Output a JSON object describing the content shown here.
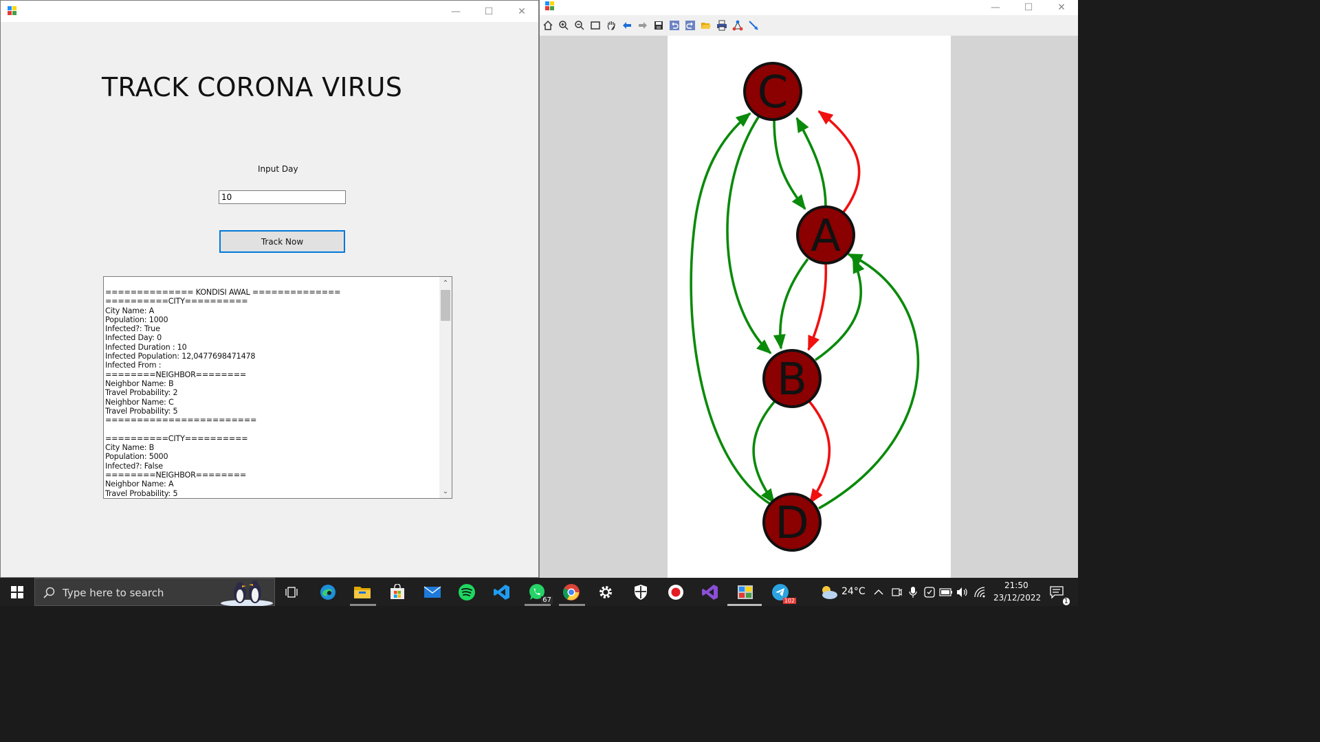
{
  "left_window": {
    "title": "TRACK CORONA VIRUS",
    "input_label": "Input Day",
    "input_value": "10",
    "button_label": "Track Now",
    "output_lines": [
      "============== KONDISI AWAL ==============",
      "==========CITY==========",
      "City Name: A",
      "Population: 1000",
      "Infected?: True",
      "Infected Day: 0",
      "Infected Duration : 10",
      "Infected Population: 12,0477698471478",
      "Infected From :",
      "========NEIGHBOR========",
      "Neighbor Name: B",
      "Travel Probability: 2",
      "Neighbor Name: C",
      "Travel Probability: 5",
      "========================",
      "",
      "==========CITY==========",
      "City Name: B",
      "Population: 5000",
      "Infected?: False",
      "========NEIGHBOR========",
      "Neighbor Name: A",
      "Travel Probability: 5"
    ]
  },
  "right_window": {
    "toolbar": [
      "home-icon",
      "zoom-in-icon",
      "zoom-out-icon",
      "zoom-box-icon",
      "pan-hand-icon",
      "back-arrow-icon",
      "forward-arrow-icon",
      "save-icon",
      "undo-icon",
      "redo-icon",
      "open-folder-icon",
      "print-icon",
      "layout-icon",
      "edge-tool-icon"
    ],
    "graph": {
      "nodes": [
        "C",
        "A",
        "B",
        "D"
      ],
      "node_color": "#8b0000",
      "edge_colors": {
        "green": "#0a8a0a",
        "red": "#f01010"
      },
      "edges": [
        {
          "from": "C",
          "to": "A",
          "color": "green"
        },
        {
          "from": "A",
          "to": "C",
          "color": "green"
        },
        {
          "from": "A",
          "to": "C",
          "color": "red"
        },
        {
          "from": "C",
          "to": "B",
          "color": "green"
        },
        {
          "from": "A",
          "to": "B",
          "color": "green"
        },
        {
          "from": "A",
          "to": "B",
          "color": "red"
        },
        {
          "from": "B",
          "to": "A",
          "color": "green"
        },
        {
          "from": "D",
          "to": "C",
          "color": "green"
        },
        {
          "from": "D",
          "to": "A",
          "color": "green"
        },
        {
          "from": "B",
          "to": "D",
          "color": "green"
        },
        {
          "from": "B",
          "to": "D",
          "color": "red"
        }
      ]
    }
  },
  "taskbar": {
    "search_placeholder": "Type here to search",
    "whatsapp_badge": "67",
    "telegram_badge": "102",
    "temperature": "24°C",
    "time": "21:50",
    "date": "23/12/2022",
    "notification_count": "1"
  }
}
